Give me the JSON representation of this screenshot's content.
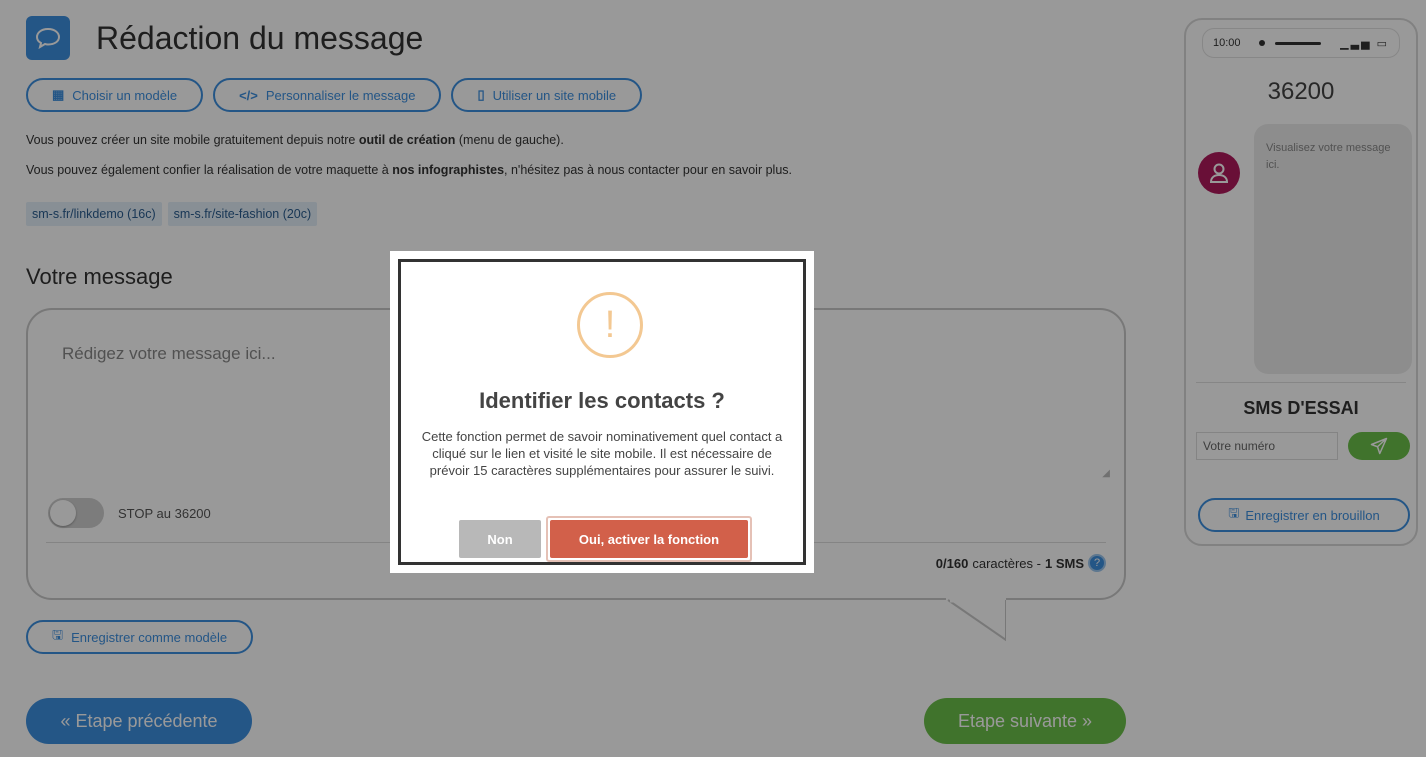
{
  "header": {
    "title": "Rédaction du message",
    "icon": "speech-bubble-icon"
  },
  "toolbar": {
    "choose_template": "Choisir un modèle",
    "personalize": "Personnaliser le message",
    "use_mobile_site": "Utiliser un site mobile"
  },
  "info": {
    "line1_pre": "Vous pouvez créer un site mobile gratuitement depuis notre ",
    "line1_bold": "outil de création",
    "line1_post": " (menu de gauche).",
    "line2_pre": "Vous pouvez également confier la réalisation de votre maquette à ",
    "line2_bold": "nos infographistes",
    "line2_post": ", n'hésitez pas à nous contacter pour en savoir plus."
  },
  "links": [
    "sm-s.fr/linkdemo (16c)",
    "sm-s.fr/site-fashion (20c)"
  ],
  "message": {
    "section_title": "Votre message",
    "placeholder": "Rédigez votre message ici...",
    "stop_label": "STOP au 36200",
    "stop_enabled": false,
    "counter_count": "0/160",
    "counter_mid": " caractères - ",
    "counter_sms": "1 SMS"
  },
  "save_template": "Enregistrer comme modèle",
  "nav": {
    "prev": "« Etape précédente",
    "next": "Etape suivante »"
  },
  "phone": {
    "time": "10:00",
    "sender": "36200",
    "preview_text": "Visualisez votre message ici.",
    "test_title": "SMS D'ESSAI",
    "number_placeholder": "Votre numéro",
    "save_draft": "Enregistrer en brouillon"
  },
  "modal": {
    "icon_glyph": "!",
    "title": "Identifier les contacts ?",
    "text": "Cette fonction permet de savoir nominativement quel contact a cliqué sur le lien et visité le site mobile. Il est nécessaire de prévoir 15 caractères supplémentaires pour assurer le suivi.",
    "no_label": "Non",
    "yes_label": "Oui, activer la fonction"
  },
  "colors": {
    "primary": "#3d8fe0",
    "success": "#6cc04a",
    "warning": "#f3c892",
    "confirm": "#d2604a",
    "avatar": "#b0195d"
  }
}
